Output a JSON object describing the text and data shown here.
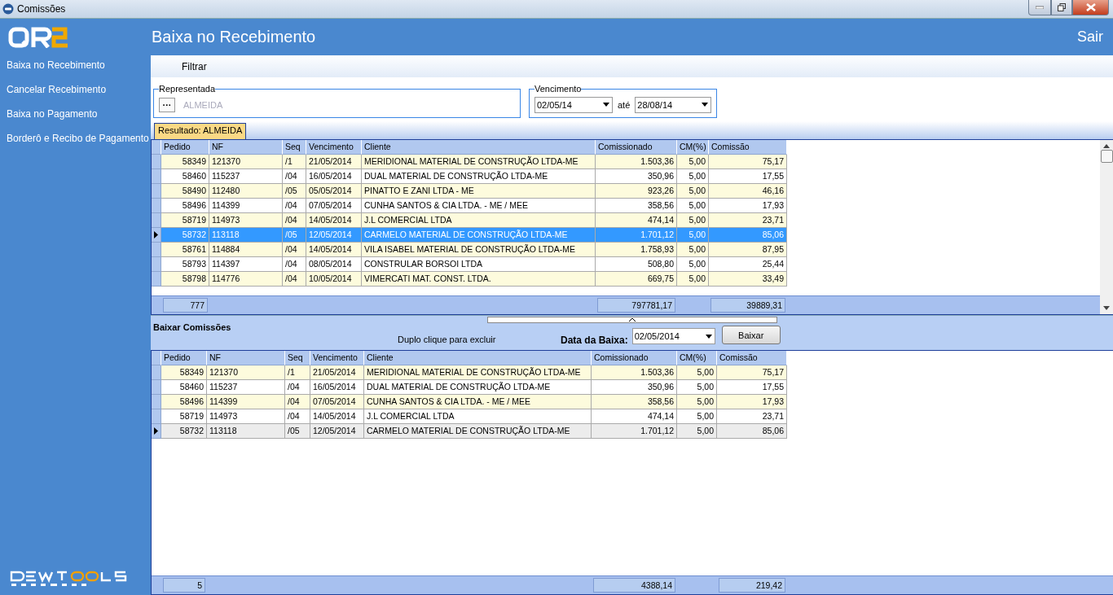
{
  "window": {
    "title": "Comissões"
  },
  "sidebar": {
    "items": [
      {
        "label": "Baixa no Recebimento"
      },
      {
        "label": "Cancelar Recebimento"
      },
      {
        "label": "Baixa no Pagamento"
      },
      {
        "label": "Borderô e Recibo de Pagamento"
      }
    ]
  },
  "header": {
    "title": "Baixa no Recebimento",
    "exit": "Sair"
  },
  "toolbar": {
    "items": [
      "Filtrar"
    ]
  },
  "filters": {
    "representada": {
      "label": "Representada",
      "button": "···",
      "value": "ALMEIDA"
    },
    "vencimento": {
      "label": "Vencimento",
      "from": "02/05/14",
      "separator": "até",
      "to": "28/08/14"
    }
  },
  "result_tab": {
    "label": "Resultado: ALMEIDA",
    "selected": true
  },
  "results_table": {
    "focused": true,
    "columns": [
      "Pedido",
      "NF",
      "Seq",
      "Vencimento",
      "Cliente",
      "Comissionado",
      "CM(%)",
      "Comissão"
    ],
    "rows": [
      {
        "cells": [
          "58349",
          "121370",
          "/1",
          "21/05/2014",
          "MERIDIONAL MATERIAL DE CONSTRUÇÃO LTDA-ME",
          "1.503,36",
          "5,00",
          "75,17"
        ],
        "selected": false
      },
      {
        "cells": [
          "58460",
          "115237",
          "/04",
          "16/05/2014",
          "DUAL MATERIAL DE CONSTRUÇÃO LTDA-ME",
          "350,96",
          "5,00",
          "17,55"
        ],
        "selected": false
      },
      {
        "cells": [
          "58490",
          "112480",
          "/05",
          "05/05/2014",
          "PINATTO E ZANI LTDA - ME",
          "923,26",
          "5,00",
          "46,16"
        ],
        "selected": false
      },
      {
        "cells": [
          "58496",
          "114399",
          "/04",
          "07/05/2014",
          "CUNHA SANTOS & CIA LTDA. - ME / MEE",
          "358,56",
          "5,00",
          "17,93"
        ],
        "selected": false
      },
      {
        "cells": [
          "58719",
          "114973",
          "/04",
          "14/05/2014",
          "J.L COMERCIAL LTDA",
          "474,14",
          "5,00",
          "23,71"
        ],
        "selected": false
      },
      {
        "cells": [
          "58732",
          "113118",
          "/05",
          "12/05/2014",
          "CARMELO MATERIAL DE CONSTRUÇÃO LTDA-ME",
          "1.701,12",
          "5,00",
          "85,06"
        ],
        "selected": true
      },
      {
        "cells": [
          "58761",
          "114884",
          "/04",
          "14/05/2014",
          "VILA ISABEL MATERIAL DE CONSTRUÇÃO LTDA-ME",
          "1.758,93",
          "5,00",
          "87,95"
        ],
        "selected": false
      },
      {
        "cells": [
          "58793",
          "114397",
          "/04",
          "08/05/2014",
          "CONSTRULAR BORSOI LTDA",
          "508,80",
          "5,00",
          "25,44"
        ],
        "selected": false
      },
      {
        "cells": [
          "58798",
          "114776",
          "/04",
          "10/05/2014",
          "VIMERCATI MAT. CONST. LTDA.",
          "669,75",
          "5,00",
          "33,49"
        ],
        "selected": false
      }
    ],
    "totals": {
      "count": "777",
      "comissionado": "797781,17",
      "comissao": "39889,31"
    }
  },
  "baixar": {
    "title": "Baixar Comissões",
    "hint": "Duplo clique para excluir",
    "date_label": "Data da Baixa:",
    "date": "02/05/2014",
    "button": "Baixar"
  },
  "baixa_table": {
    "focused": false,
    "columns": [
      "Pedido",
      "NF",
      "Seq",
      "Vencimento",
      "Cliente",
      "Comissionado",
      "CM(%)",
      "Comissão"
    ],
    "rows": [
      {
        "cells": [
          "58349",
          "121370",
          "/1",
          "21/05/2014",
          "MERIDIONAL MATERIAL DE CONSTRUÇÃO LTDA-ME",
          "1.503,36",
          "5,00",
          "75,17"
        ],
        "selected": false
      },
      {
        "cells": [
          "58460",
          "115237",
          "/04",
          "16/05/2014",
          "DUAL MATERIAL DE CONSTRUÇÃO LTDA-ME",
          "350,96",
          "5,00",
          "17,55"
        ],
        "selected": false
      },
      {
        "cells": [
          "58496",
          "114399",
          "/04",
          "07/05/2014",
          "CUNHA SANTOS & CIA LTDA. - ME / MEE",
          "358,56",
          "5,00",
          "17,93"
        ],
        "selected": false
      },
      {
        "cells": [
          "58719",
          "114973",
          "/04",
          "14/05/2014",
          "J.L COMERCIAL LTDA",
          "474,14",
          "5,00",
          "23,71"
        ],
        "selected": false
      },
      {
        "cells": [
          "58732",
          "113118",
          "/05",
          "12/05/2014",
          "CARMELO MATERIAL DE CONSTRUÇÃO LTDA-ME",
          "1.701,12",
          "5,00",
          "85,06"
        ],
        "selected": true
      }
    ],
    "totals": {
      "count": "5",
      "comissionado": "4388,14",
      "comissao": "219,42"
    }
  }
}
